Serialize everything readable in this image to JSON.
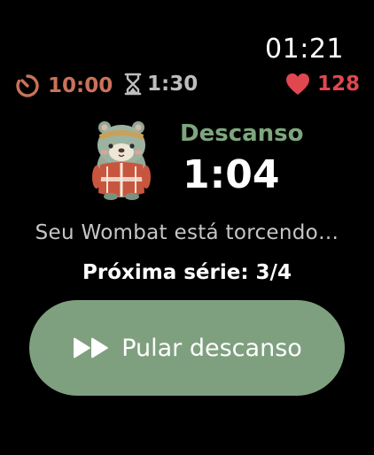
{
  "status": {
    "clock": "01:21"
  },
  "stats": {
    "total_time": "10:00",
    "rest_time": "1:30",
    "heart_rate": "128",
    "colors": {
      "total": "#c9735a",
      "rest": "#bdbdbd",
      "heart": "#e0474f"
    }
  },
  "rest": {
    "label": "Descanso",
    "timer": "1:04",
    "mascot": "wombat-mascot",
    "cheer_text": "Seu Wombat está torcendo…",
    "next_set": "Próxima série: 3/4"
  },
  "actions": {
    "skip_label": "Pular descanso",
    "skip_icon": "fast-forward-icon",
    "accent": "#7fa07f"
  }
}
